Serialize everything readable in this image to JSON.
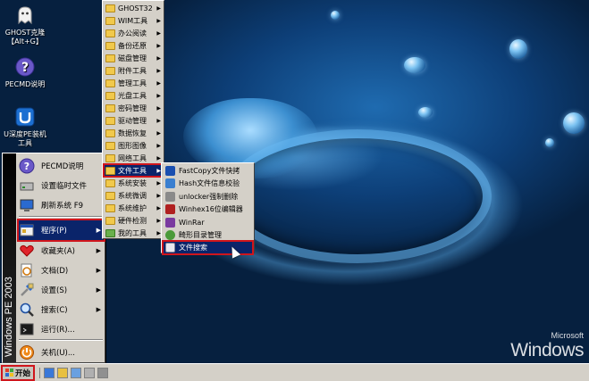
{
  "desktop": {
    "icons": [
      {
        "label_line1": "GHOST克隆",
        "label_line2": "【Alt+G】"
      },
      {
        "label_line1": "PECMD说明",
        "label_line2": ""
      },
      {
        "label_line1": "U深度PE装机",
        "label_line2": "工具"
      }
    ],
    "watermark_small": "Microsoft",
    "watermark_large": "Windows"
  },
  "start_menu": {
    "band_text": "Windows PE 2003",
    "items": [
      {
        "label": "PECMD说明",
        "icon": "question-icon"
      },
      {
        "label": "设置临时文件",
        "icon": "drive-icon"
      },
      {
        "label": "刷新系统 F9",
        "icon": "monitor-icon"
      },
      {
        "label": "程序(P)",
        "icon": "programs-icon",
        "has_submenu": true
      },
      {
        "label": "收藏夹(A)",
        "icon": "heart-icon",
        "has_submenu": true
      },
      {
        "label": "文档(D)",
        "icon": "documents-icon",
        "has_submenu": true
      },
      {
        "label": "设置(S)",
        "icon": "settings-icon",
        "has_submenu": true
      },
      {
        "label": "搜索(C)",
        "icon": "search-icon",
        "has_submenu": true
      },
      {
        "label": "运行(R)...",
        "icon": "run-icon"
      },
      {
        "label": "关机(U)...",
        "icon": "shutdown-icon"
      }
    ]
  },
  "programs_menu": {
    "items": [
      {
        "label": "GHOST32"
      },
      {
        "label": "WIM工具"
      },
      {
        "label": "办公阅读"
      },
      {
        "label": "备份还原"
      },
      {
        "label": "磁盘管理"
      },
      {
        "label": "附件工具"
      },
      {
        "label": "管理工具"
      },
      {
        "label": "光盘工具"
      },
      {
        "label": "密码管理"
      },
      {
        "label": "驱动管理"
      },
      {
        "label": "数据恢复"
      },
      {
        "label": "图形图像"
      },
      {
        "label": "网络工具"
      },
      {
        "label": "文件工具"
      },
      {
        "label": "系统安装"
      },
      {
        "label": "系统微调"
      },
      {
        "label": "系统维护"
      },
      {
        "label": "硬件检测"
      },
      {
        "label": "我的工具"
      }
    ]
  },
  "file_tools_menu": {
    "items": [
      {
        "label": "FastCopy文件快拷",
        "color": "#1a4fb0"
      },
      {
        "label": "Hash文件信息校验",
        "color": "#3a7fd0"
      },
      {
        "label": "unlocker强制删除",
        "color": "#8a8a8a"
      },
      {
        "label": "Winhex16位编辑器",
        "color": "#b02020"
      },
      {
        "label": "WinRar",
        "color": "#7a3aa0"
      },
      {
        "label": "畸形目录管理",
        "color": "#4a9a3a"
      },
      {
        "label": "文件搜索",
        "color": "#e8e8f0"
      }
    ]
  },
  "taskbar": {
    "start_label": "开始"
  },
  "colors": {
    "highlight": "#0a246a",
    "annotation_red": "#d0151c",
    "menu_bg": "#d4d0c8"
  }
}
